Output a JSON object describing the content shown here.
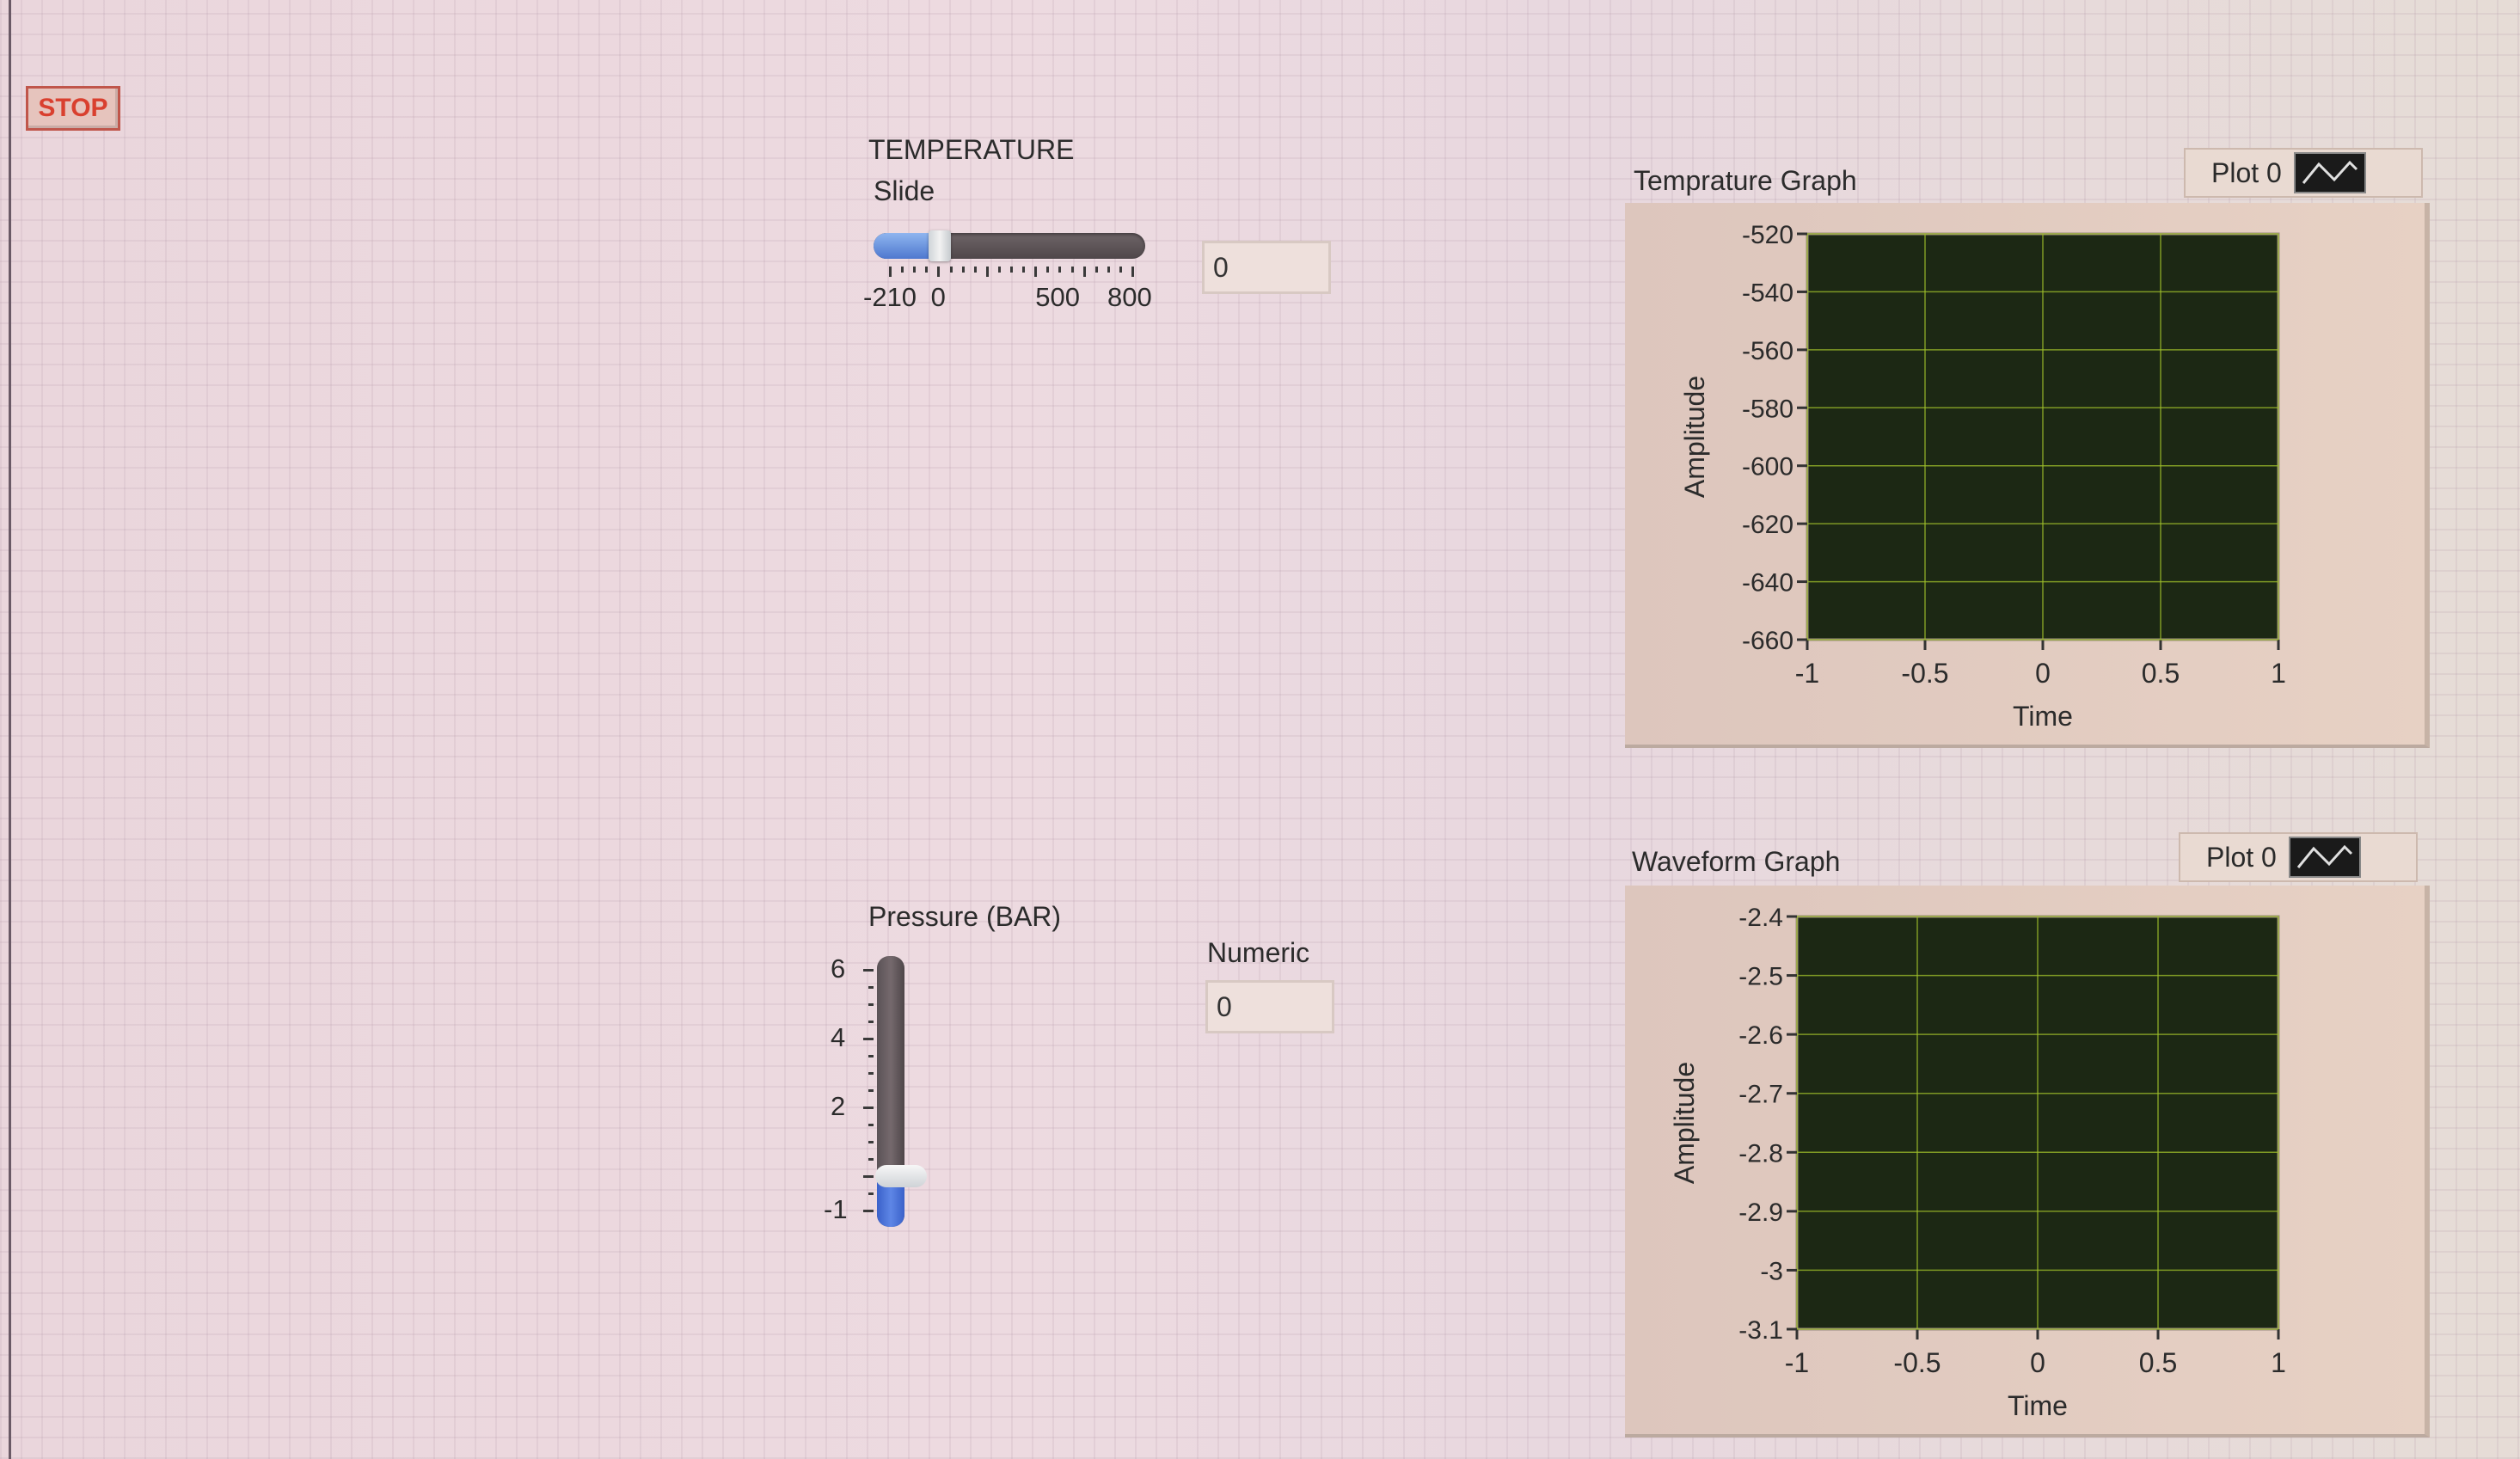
{
  "stop_button": {
    "label": "STOP"
  },
  "temperature": {
    "caption": "TEMPERATURE",
    "slide_label": "Slide",
    "ticks": [
      "-210",
      "0",
      "500",
      "800"
    ],
    "range": [
      -210,
      800
    ],
    "value": 0,
    "display_value": "0"
  },
  "pressure": {
    "label": "Pressure (BAR)",
    "ticks": [
      "6",
      "4",
      "2",
      "-1"
    ],
    "range": [
      -1,
      6
    ],
    "value": 0
  },
  "numeric": {
    "label": "Numeric",
    "value": "0"
  },
  "temp_graph": {
    "title": "Temprature  Graph",
    "plot_label": "Plot 0",
    "plot_icon": "waveform-icon",
    "plot_bg": "#1c2814",
    "grid_color": "#9fbf2a",
    "chart_data": {
      "type": "line",
      "xlabel": "Time",
      "ylabel": "Amplitude",
      "xlim": [
        -1,
        1
      ],
      "ylim": [
        -660,
        -520
      ],
      "xticks": [
        "-1",
        "-0.5",
        "0",
        "0.5",
        "1"
      ],
      "yticks": [
        "-520",
        "-540",
        "-560",
        "-580",
        "-600",
        "-620",
        "-640",
        "-660"
      ],
      "series": []
    }
  },
  "wave_graph": {
    "title": "Waveform Graph",
    "plot_label": "Plot 0",
    "plot_icon": "waveform-icon",
    "plot_bg": "#1c2814",
    "grid_color": "#9fbf2a",
    "chart_data": {
      "type": "line",
      "xlabel": "Time",
      "ylabel": "Amplitude",
      "xlim": [
        -1,
        1
      ],
      "ylim": [
        -3.1,
        -2.4
      ],
      "xticks": [
        "-1",
        "-0.5",
        "0",
        "0.5",
        "1"
      ],
      "yticks": [
        "-2.4",
        "-2.5",
        "-2.6",
        "-2.7",
        "-2.8",
        "-2.9",
        "-3",
        "-3.1"
      ],
      "series": []
    }
  }
}
